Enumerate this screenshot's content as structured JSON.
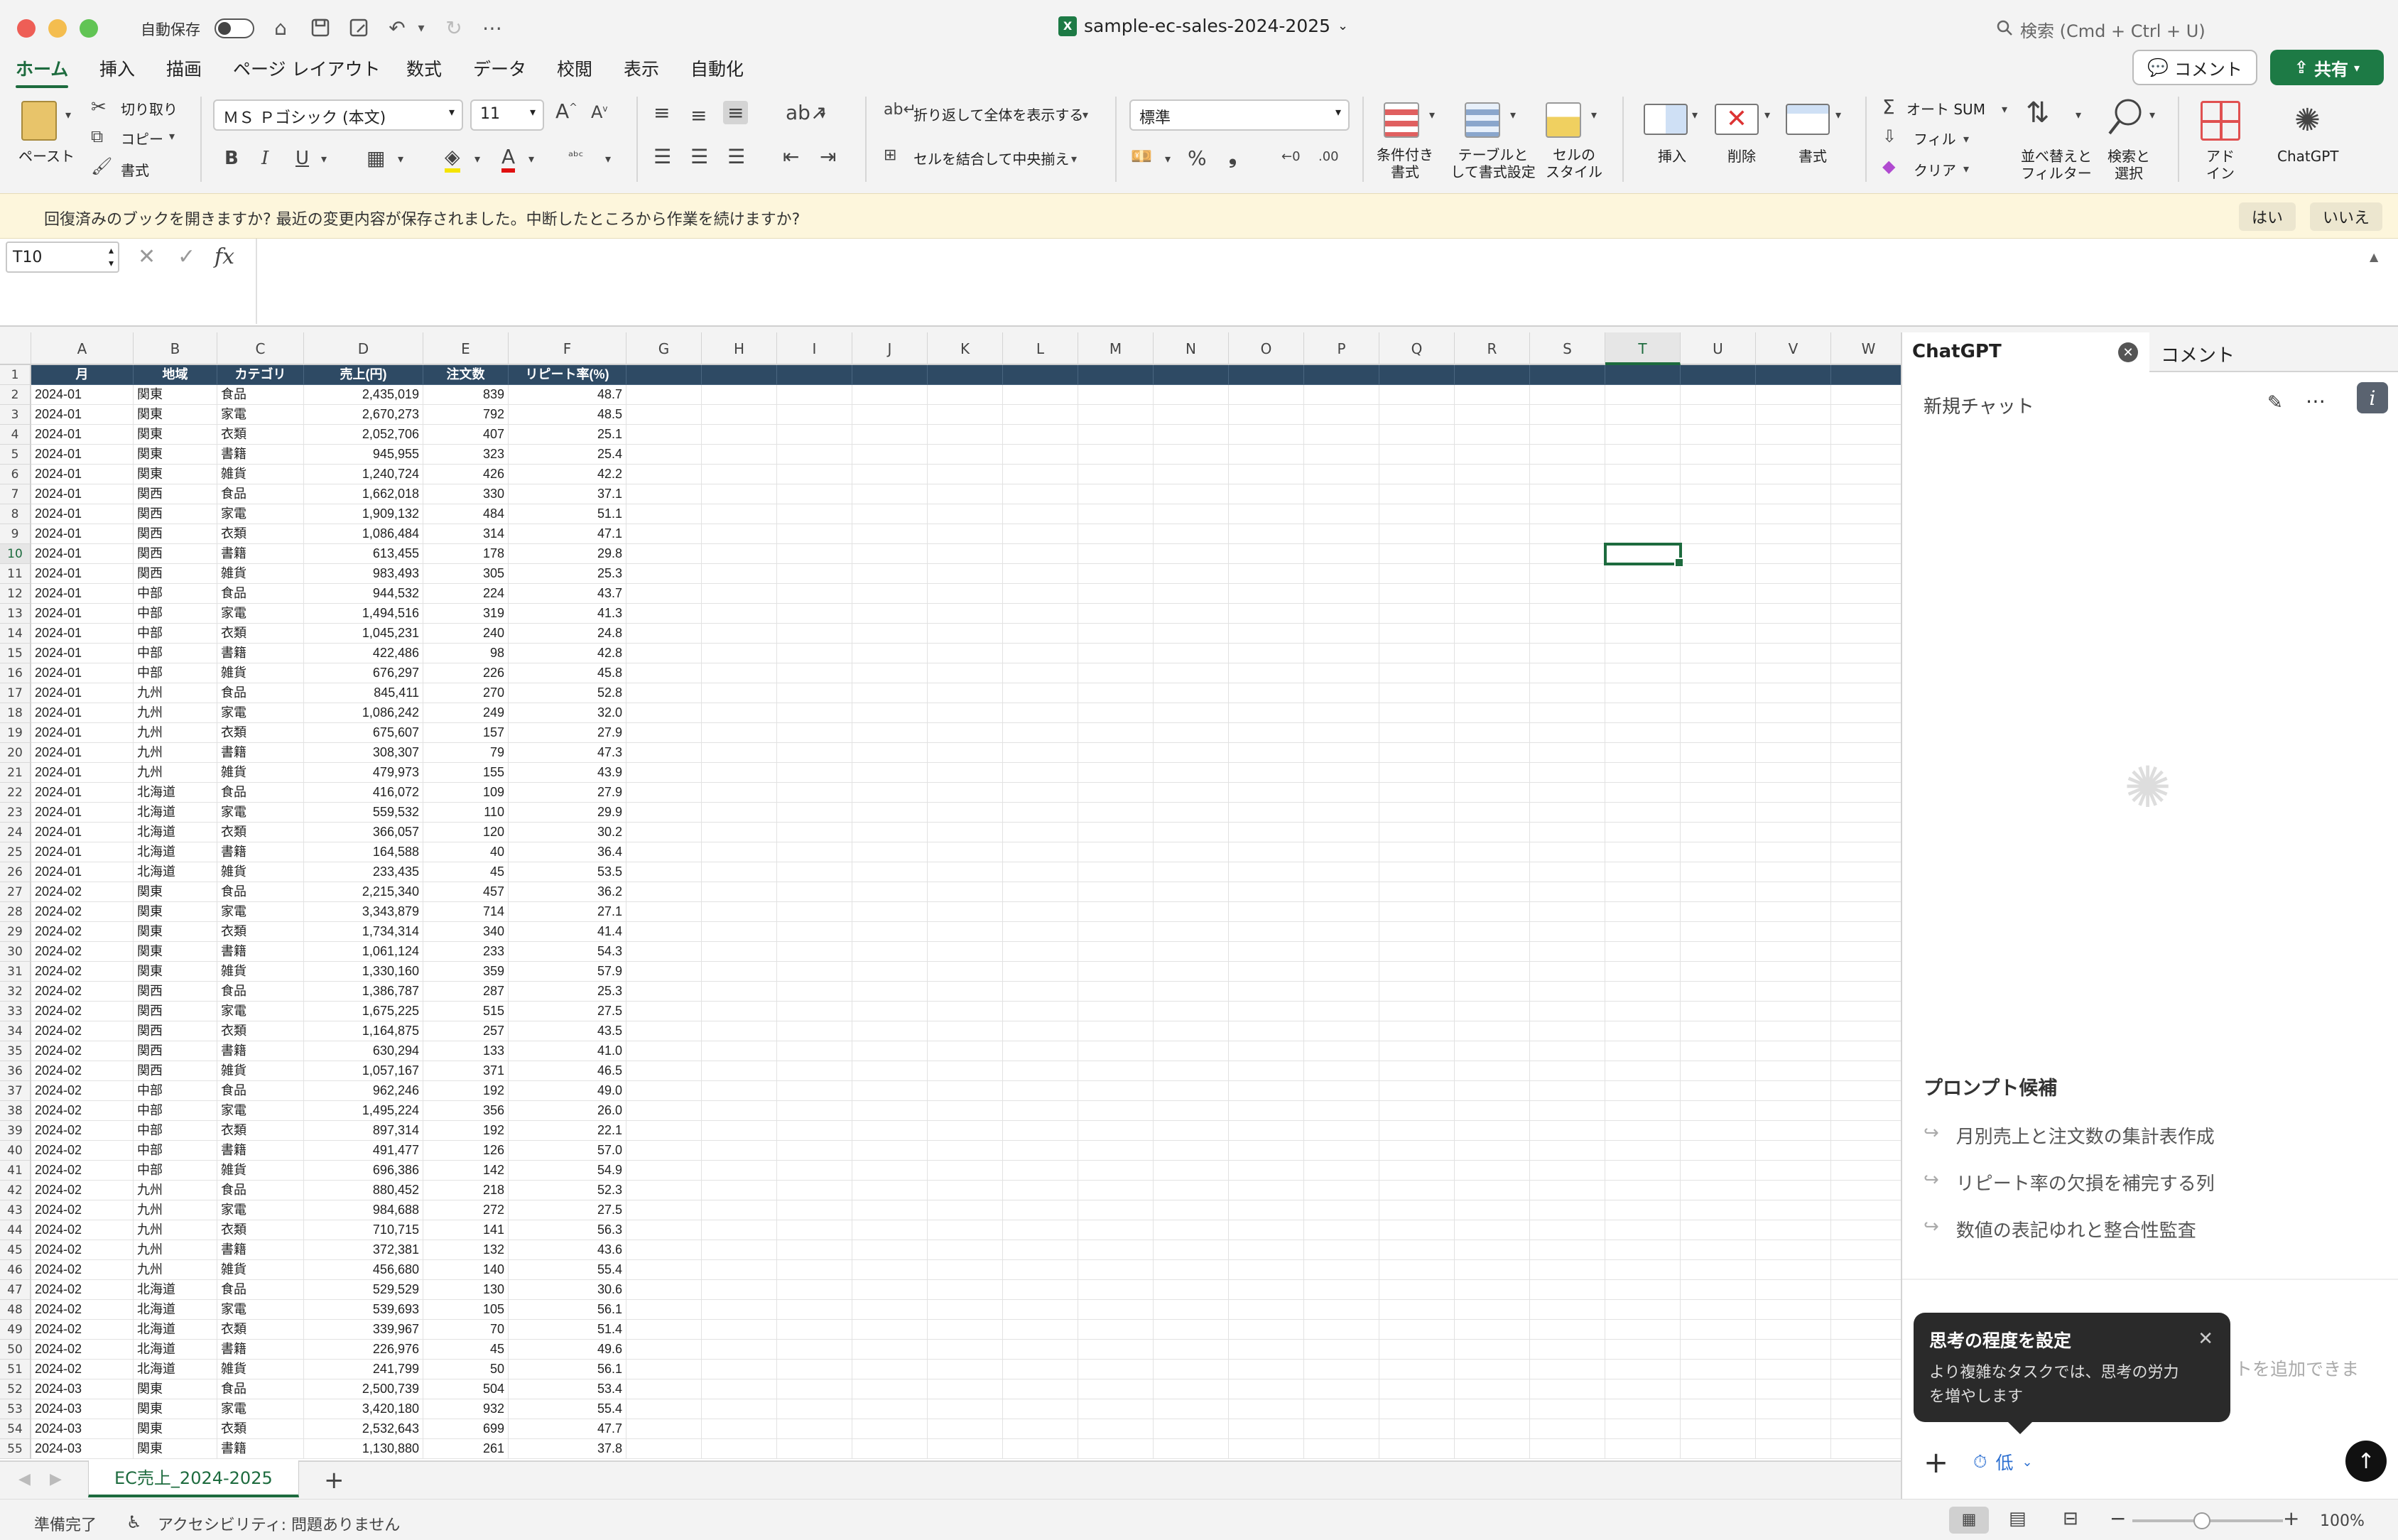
{
  "titlebar": {
    "autosave_label": "自動保存",
    "doc_title": "sample-ec-sales-2024-2025",
    "search_placeholder": "検索 (Cmd + Ctrl + U)"
  },
  "ribbon_tabs": [
    "ホーム",
    "挿入",
    "描画",
    "ページ レイアウト",
    "数式",
    "データ",
    "校閲",
    "表示",
    "自動化"
  ],
  "toolbar": {
    "comment_label": "コメント",
    "share_label": "共有",
    "paste": "ペースト",
    "cut": "切り取り",
    "copy": "コピー",
    "format_painter": "書式",
    "font_name": "ＭＳ Ｐゴシック (本文)",
    "font_size": "11",
    "wrap_text": "折り返して全体を表示する",
    "merge_center": "セルを結合して中央揃え",
    "number_format": "標準",
    "conditional_format": [
      "条件付き",
      "書式"
    ],
    "table_format": [
      "テーブルと",
      "して書式設定"
    ],
    "cell_style": [
      "セルの",
      "スタイル"
    ],
    "insert": "挿入",
    "delete": "削除",
    "format": "書式",
    "autosum": "オート SUM",
    "fill": "フィル",
    "clear": "クリア",
    "sort_filter": [
      "並べ替えと",
      "フィルター"
    ],
    "find_select": [
      "検索と",
      "選択"
    ],
    "addin": [
      "アド",
      "イン"
    ],
    "chatgpt": "ChatGPT"
  },
  "infobar": {
    "message": "回復済みのブックを開きますか?  最近の変更内容が保存されました。中断したところから作業を続けますか?",
    "yes": "はい",
    "no": "いいえ"
  },
  "formulabar": {
    "namebox": "T10",
    "fx": "fx"
  },
  "columns": [
    "A",
    "B",
    "C",
    "D",
    "E",
    "F",
    "G",
    "H",
    "I",
    "J",
    "K",
    "L",
    "M",
    "N",
    "O",
    "P",
    "Q",
    "R",
    "S",
    "T",
    "U",
    "V",
    "W"
  ],
  "selected_cell": "T10",
  "table": {
    "headers": [
      "月",
      "地域",
      "カテゴリ",
      "売上(円)",
      "注文数",
      "リピート率(%)"
    ],
    "rows": [
      [
        "2024-01",
        "関東",
        "食品",
        "2,435,019",
        "839",
        "48.7"
      ],
      [
        "2024-01",
        "関東",
        "家電",
        "2,670,273",
        "792",
        "48.5"
      ],
      [
        "2024-01",
        "関東",
        "衣類",
        "2,052,706",
        "407",
        "25.1"
      ],
      [
        "2024-01",
        "関東",
        "書籍",
        "945,955",
        "323",
        "25.4"
      ],
      [
        "2024-01",
        "関東",
        "雑貨",
        "1,240,724",
        "426",
        "42.2"
      ],
      [
        "2024-01",
        "関西",
        "食品",
        "1,662,018",
        "330",
        "37.1"
      ],
      [
        "2024-01",
        "関西",
        "家電",
        "1,909,132",
        "484",
        "51.1"
      ],
      [
        "2024-01",
        "関西",
        "衣類",
        "1,086,484",
        "314",
        "47.1"
      ],
      [
        "2024-01",
        "関西",
        "書籍",
        "613,455",
        "178",
        "29.8"
      ],
      [
        "2024-01",
        "関西",
        "雑貨",
        "983,493",
        "305",
        "25.3"
      ],
      [
        "2024-01",
        "中部",
        "食品",
        "944,532",
        "224",
        "43.7"
      ],
      [
        "2024-01",
        "中部",
        "家電",
        "1,494,516",
        "319",
        "41.3"
      ],
      [
        "2024-01",
        "中部",
        "衣類",
        "1,045,231",
        "240",
        "24.8"
      ],
      [
        "2024-01",
        "中部",
        "書籍",
        "422,486",
        "98",
        "42.8"
      ],
      [
        "2024-01",
        "中部",
        "雑貨",
        "676,297",
        "226",
        "45.8"
      ],
      [
        "2024-01",
        "九州",
        "食品",
        "845,411",
        "270",
        "52.8"
      ],
      [
        "2024-01",
        "九州",
        "家電",
        "1,086,242",
        "249",
        "32.0"
      ],
      [
        "2024-01",
        "九州",
        "衣類",
        "675,607",
        "157",
        "27.9"
      ],
      [
        "2024-01",
        "九州",
        "書籍",
        "308,307",
        "79",
        "47.3"
      ],
      [
        "2024-01",
        "九州",
        "雑貨",
        "479,973",
        "155",
        "43.9"
      ],
      [
        "2024-01",
        "北海道",
        "食品",
        "416,072",
        "109",
        "27.9"
      ],
      [
        "2024-01",
        "北海道",
        "家電",
        "559,532",
        "110",
        "29.9"
      ],
      [
        "2024-01",
        "北海道",
        "衣類",
        "366,057",
        "120",
        "30.2"
      ],
      [
        "2024-01",
        "北海道",
        "書籍",
        "164,588",
        "40",
        "36.4"
      ],
      [
        "2024-01",
        "北海道",
        "雑貨",
        "233,435",
        "45",
        "53.5"
      ],
      [
        "2024-02",
        "関東",
        "食品",
        "2,215,340",
        "457",
        "36.2"
      ],
      [
        "2024-02",
        "関東",
        "家電",
        "3,343,879",
        "714",
        "27.1"
      ],
      [
        "2024-02",
        "関東",
        "衣類",
        "1,734,314",
        "340",
        "41.4"
      ],
      [
        "2024-02",
        "関東",
        "書籍",
        "1,061,124",
        "233",
        "54.3"
      ],
      [
        "2024-02",
        "関東",
        "雑貨",
        "1,330,160",
        "359",
        "57.9"
      ],
      [
        "2024-02",
        "関西",
        "食品",
        "1,386,787",
        "287",
        "25.3"
      ],
      [
        "2024-02",
        "関西",
        "家電",
        "1,675,225",
        "515",
        "27.5"
      ],
      [
        "2024-02",
        "関西",
        "衣類",
        "1,164,875",
        "257",
        "43.5"
      ],
      [
        "2024-02",
        "関西",
        "書籍",
        "630,294",
        "133",
        "41.0"
      ],
      [
        "2024-02",
        "関西",
        "雑貨",
        "1,057,167",
        "371",
        "46.5"
      ],
      [
        "2024-02",
        "中部",
        "食品",
        "962,246",
        "192",
        "49.0"
      ],
      [
        "2024-02",
        "中部",
        "家電",
        "1,495,224",
        "356",
        "26.0"
      ],
      [
        "2024-02",
        "中部",
        "衣類",
        "897,314",
        "192",
        "22.1"
      ],
      [
        "2024-02",
        "中部",
        "書籍",
        "491,477",
        "126",
        "57.0"
      ],
      [
        "2024-02",
        "中部",
        "雑貨",
        "696,386",
        "142",
        "54.9"
      ],
      [
        "2024-02",
        "九州",
        "食品",
        "880,452",
        "218",
        "52.3"
      ],
      [
        "2024-02",
        "九州",
        "家電",
        "984,688",
        "272",
        "27.5"
      ],
      [
        "2024-02",
        "九州",
        "衣類",
        "710,715",
        "141",
        "56.3"
      ],
      [
        "2024-02",
        "九州",
        "書籍",
        "372,381",
        "132",
        "43.6"
      ],
      [
        "2024-02",
        "九州",
        "雑貨",
        "456,680",
        "140",
        "55.4"
      ],
      [
        "2024-02",
        "北海道",
        "食品",
        "529,529",
        "130",
        "30.6"
      ],
      [
        "2024-02",
        "北海道",
        "家電",
        "539,693",
        "105",
        "56.1"
      ],
      [
        "2024-02",
        "北海道",
        "衣類",
        "339,967",
        "70",
        "51.4"
      ],
      [
        "2024-02",
        "北海道",
        "書籍",
        "226,976",
        "45",
        "49.6"
      ],
      [
        "2024-02",
        "北海道",
        "雑貨",
        "241,799",
        "50",
        "56.1"
      ],
      [
        "2024-03",
        "関東",
        "食品",
        "2,500,739",
        "504",
        "53.4"
      ],
      [
        "2024-03",
        "関東",
        "家電",
        "3,420,180",
        "932",
        "55.4"
      ],
      [
        "2024-03",
        "関東",
        "衣類",
        "2,532,643",
        "699",
        "47.7"
      ],
      [
        "2024-03",
        "関東",
        "書籍",
        "1,130,880",
        "261",
        "37.8"
      ]
    ]
  },
  "sheet_tab": "EC売上_2024-2025",
  "statusbar": {
    "ready": "準備完了",
    "accessibility": "アクセシビリティ: 問題ありません",
    "zoom": "100%"
  },
  "panel": {
    "tab_chatgpt": "ChatGPT",
    "tab_comment": "コメント",
    "new_chat": "新規チャット",
    "suggest_title": "プロンプト候補",
    "suggestions": [
      "月別売上と注文数の集計表作成",
      "リピート率の欠損を補完する列",
      "数値の表記ゆれと整合性監査"
    ],
    "tooltip_title": "思考の程度を設定",
    "tooltip_body": "より複雑なタスクでは、思考の労力を増やします",
    "hidden_placeholder": "トを追加できま",
    "effort": "低"
  }
}
